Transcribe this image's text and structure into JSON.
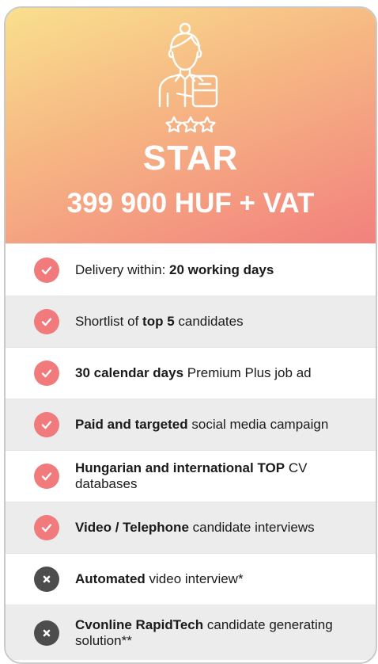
{
  "plan": {
    "name": "STAR",
    "price": "399 900 HUF + VAT"
  },
  "colors": {
    "gradient_start": "#f9e08e",
    "gradient_end": "#f2817e",
    "check_badge": "#f17a7c",
    "cross_badge": "#4d4d4d"
  },
  "features": [
    {
      "included": true,
      "icon": "check-icon",
      "parts": [
        "Delivery within: ",
        "20 working days",
        ""
      ]
    },
    {
      "included": true,
      "icon": "check-icon",
      "parts": [
        "Shortlist of ",
        "top 5",
        " candidates"
      ]
    },
    {
      "included": true,
      "icon": "check-icon",
      "parts": [
        "",
        "30 calendar days",
        " Premium Plus job ad"
      ]
    },
    {
      "included": true,
      "icon": "check-icon",
      "parts": [
        "",
        "Paid and targeted",
        " social media campaign"
      ]
    },
    {
      "included": true,
      "icon": "check-icon",
      "parts": [
        "",
        "Hungarian and international TOP",
        " CV databases"
      ]
    },
    {
      "included": true,
      "icon": "check-icon",
      "parts": [
        "",
        "Video / Telephone",
        " candidate interviews"
      ]
    },
    {
      "included": false,
      "icon": "cross-icon",
      "parts": [
        "",
        "Automated",
        " video interview*"
      ]
    },
    {
      "included": false,
      "icon": "cross-icon",
      "parts": [
        "",
        "Cvonline RapidTech",
        " candidate generating solution**"
      ]
    }
  ]
}
